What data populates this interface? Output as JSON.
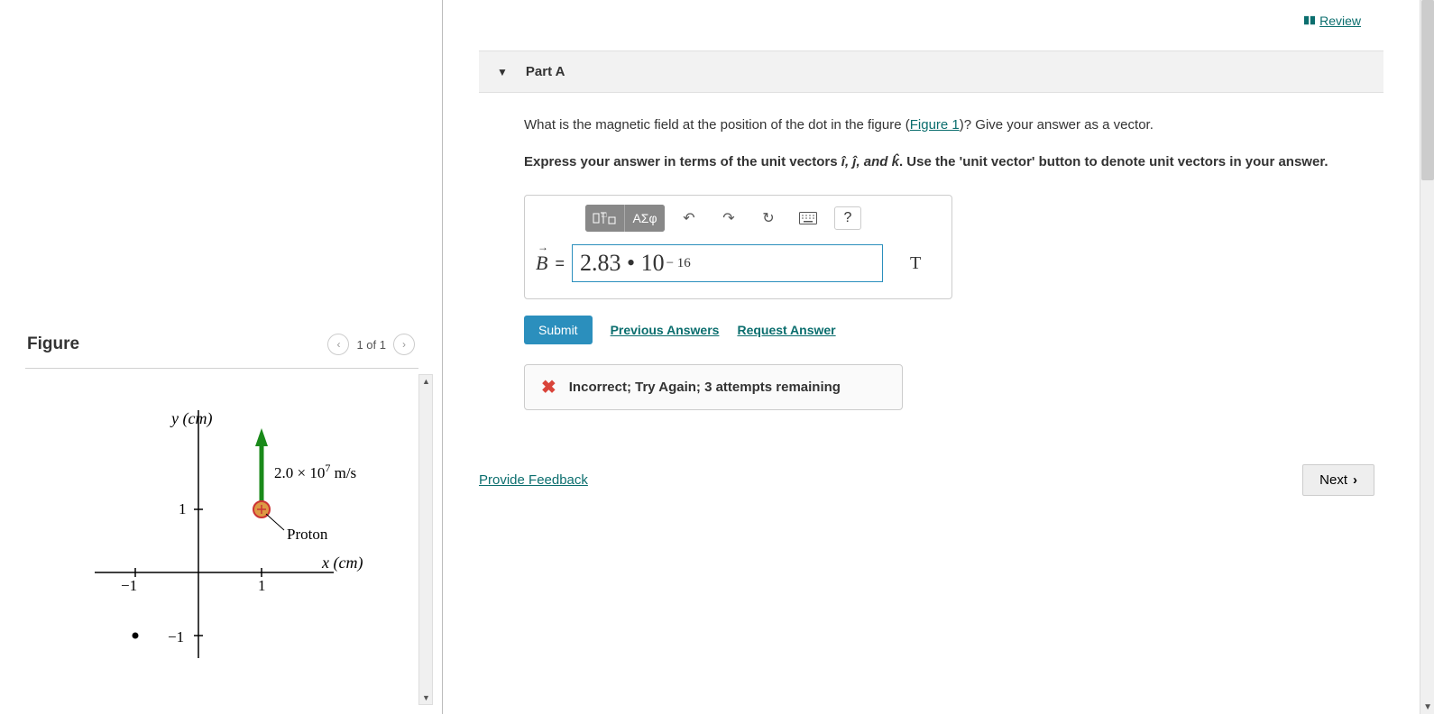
{
  "header": {
    "review_label": "Review"
  },
  "part": {
    "title": "Part A",
    "question_pre": "What is the magnetic field at the position of the dot in the figure (",
    "figure_link": "Figure 1",
    "question_post": ")? Give your answer as a vector.",
    "instruction_pre": "Express your answer in terms of the unit vectors ",
    "unit_vectors": "î, ĵ, and k̂",
    "instruction_post": ". Use the 'unit vector' button to denote unit vectors in your answer."
  },
  "toolbar": {
    "templates_tooltip": "Templates",
    "greek_label": "ΑΣφ",
    "undo_tooltip": "Undo",
    "redo_tooltip": "Redo",
    "reset_tooltip": "Reset",
    "keyboard_tooltip": "Keyboard",
    "help_label": "?"
  },
  "answer": {
    "variable": "B",
    "equals": "=",
    "entered_value": "2.83 • 10",
    "entered_exponent": "− 16",
    "unit": "T"
  },
  "actions": {
    "submit": "Submit",
    "previous": "Previous Answers",
    "request": "Request Answer"
  },
  "feedback": {
    "message": "Incorrect; Try Again; 3 attempts remaining"
  },
  "footer": {
    "provide_feedback": "Provide Feedback",
    "next": "Next"
  },
  "figure": {
    "heading": "Figure",
    "pager": "1 of 1",
    "y_axis": "y (cm)",
    "x_axis": "x (cm)",
    "velocity_label_base": "2.0 × 10",
    "velocity_label_exp": "7",
    "velocity_label_unit": " m/s",
    "particle_label": "Proton",
    "tick_pos": "1",
    "tick_neg_x": "−1",
    "tick_neg_y": "−1"
  }
}
